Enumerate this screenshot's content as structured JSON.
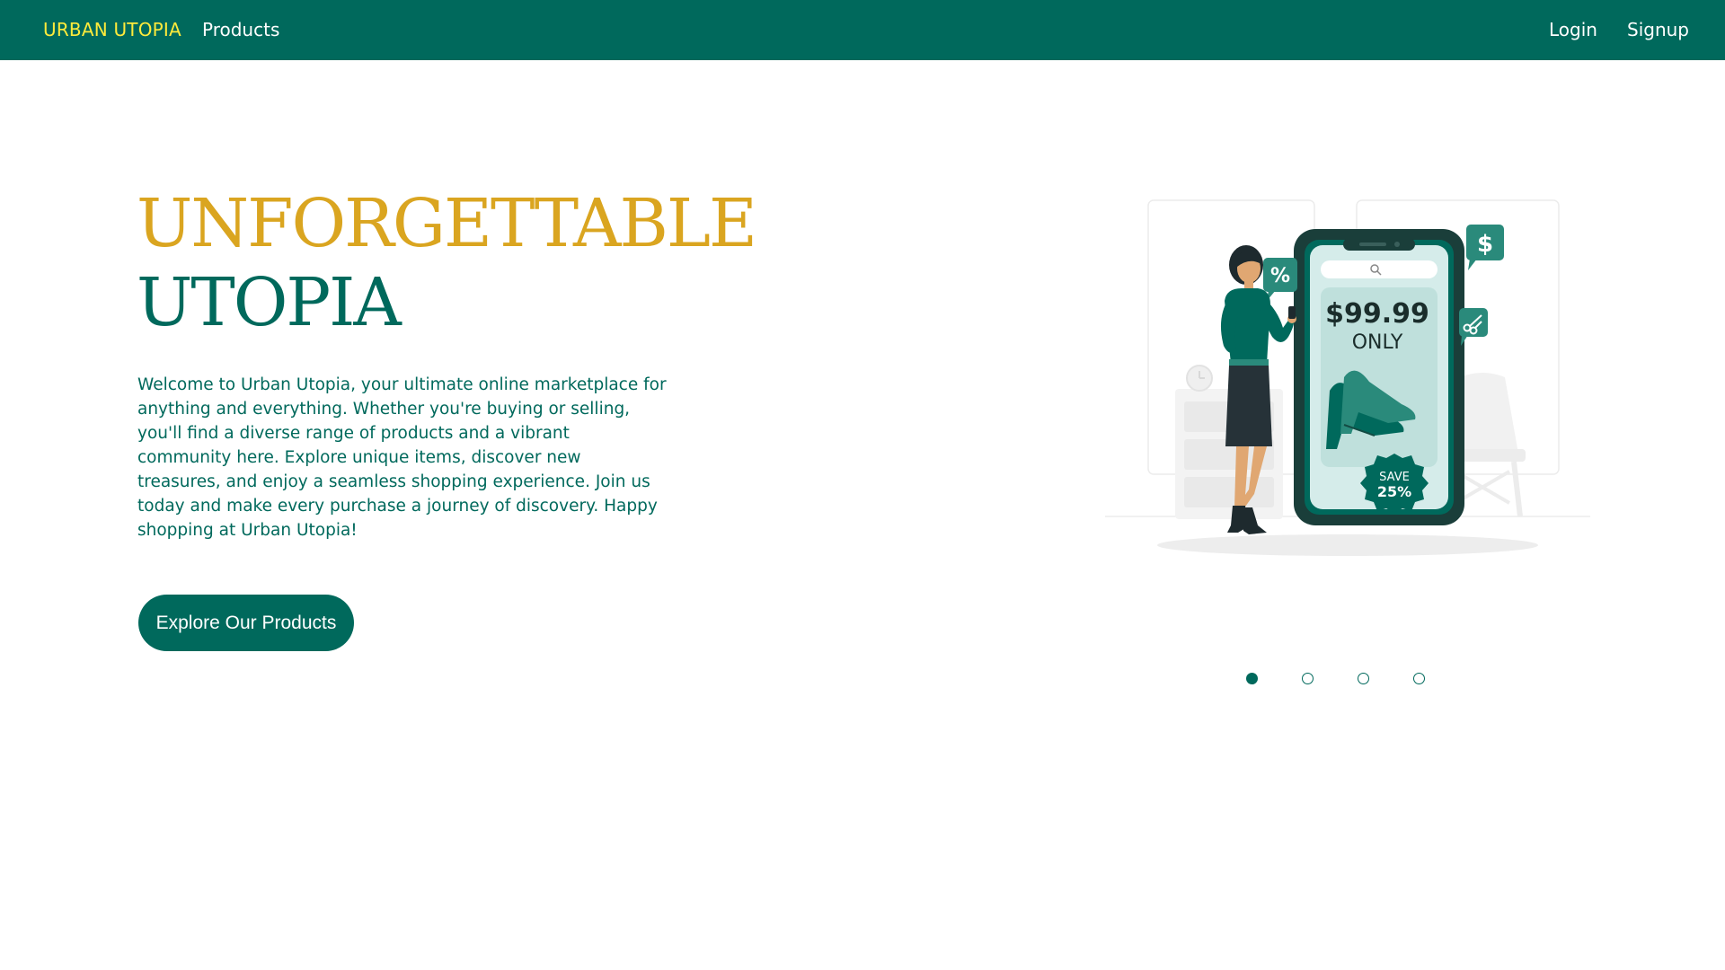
{
  "nav": {
    "brand": "URBAN UTOPIA",
    "products": "Products",
    "login": "Login",
    "signup": "Signup"
  },
  "hero": {
    "title_line1": "UNFORGETTABLE",
    "title_line2": "UTOPIA",
    "description": "Welcome to Urban Utopia, your ultimate online marketplace for anything and everything. Whether you're buying or selling, you'll find a diverse range of products and a vibrant community here. Explore unique items, discover new treasures, and enjoy a seamless shopping experience. Join us today and make every purchase a journey of discovery. Happy shopping at Urban Utopia!",
    "cta": "Explore Our Products"
  },
  "illustration": {
    "price": "$99.99",
    "price_note": "ONLY",
    "badge_line1": "SAVE",
    "badge_line2": "25%",
    "percent_bubble": "%",
    "dollar_bubble": "$"
  },
  "carousel": {
    "slide_count": 4,
    "active_index": 0
  },
  "colors": {
    "primary": "#00695c",
    "brand": "#ffeb3b",
    "accent": "#daa520"
  }
}
